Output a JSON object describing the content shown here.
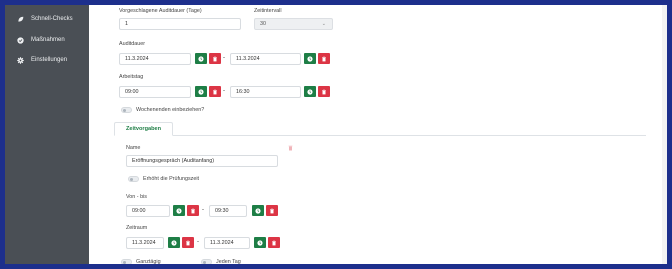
{
  "sidebar": {
    "items": [
      {
        "label": "Schnell-Checks",
        "icon": "leaf-icon"
      },
      {
        "label": "Maßnahmen",
        "icon": "check-circle-icon"
      },
      {
        "label": "Einstellungen",
        "icon": "gear-icon"
      }
    ]
  },
  "form": {
    "audit_duration_label": "Vorgeschlagene Auditdauer (Tage)",
    "audit_duration_value": "1",
    "interval_label": "Zeitintervall",
    "interval_value": "30",
    "auditdauer_label": "Auditdauer",
    "auditdauer_from": "11.3.2024",
    "auditdauer_to": "11.3.2024",
    "arbeitstag_label": "Arbeitstag",
    "arbeitstag_from": "09:00",
    "arbeitstag_to": "16:30",
    "weekends_label": "Wochenenden einbeziehen?"
  },
  "tabs": {
    "zeitvorgaben": "Zeitvorgaben"
  },
  "zeitvorgaben": {
    "name_label": "Name",
    "name_value": "Eröffnungsgespräch (Auditanfang)",
    "increase_label": "Erhöht die Prüfungszeit",
    "von_bis_label": "Von - bis",
    "von": "09:00",
    "bis": "09:30",
    "zeitraum_label": "Zeitraum",
    "zeitraum_from": "11.3.2024",
    "zeitraum_to": "11.3.2024",
    "ganztaegig_label": "Ganztägig",
    "jeden_tag_label": "Jeden Tag"
  },
  "colors": {
    "green": "#1e7e46",
    "red": "#dc3545",
    "sidebar": "#4a4f55",
    "frame": "#1d2f8c"
  }
}
